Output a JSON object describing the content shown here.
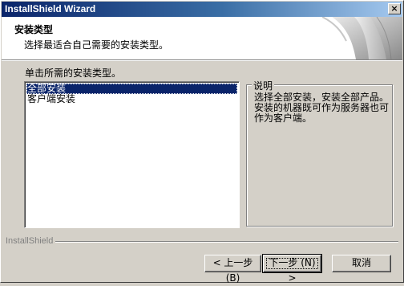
{
  "window": {
    "title": "InstallShield Wizard",
    "close_glyph": "×"
  },
  "header": {
    "title": "安装类型",
    "subtitle": "选择最适合自己需要的安装类型。"
  },
  "instruction": "单击所需的安装类型。",
  "install_types": {
    "items": [
      {
        "label": "全部安装",
        "selected": true
      },
      {
        "label": "客户端安装",
        "selected": false
      }
    ]
  },
  "description": {
    "heading": "说明",
    "text": "选择全部安装，安装全部产品。安装的机器既可作为服务器也可作为客户端。"
  },
  "footer": {
    "brand": "InstallShield"
  },
  "buttons": {
    "back": "< 上一步 (B)",
    "next": "下一步 (N) >",
    "cancel": "取消"
  },
  "colors": {
    "titlebar_start": "#0a246a",
    "titlebar_end": "#a6caf0",
    "selection": "#0a246a",
    "face": "#d4d0c8"
  }
}
